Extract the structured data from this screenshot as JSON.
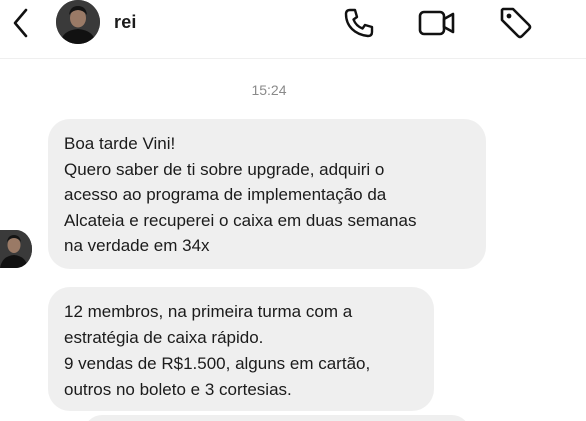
{
  "header": {
    "back_icon": "chevron-left-icon",
    "username": "rei",
    "actions": [
      {
        "icon": "phone-icon"
      },
      {
        "icon": "video-camera-icon"
      },
      {
        "icon": "tag-icon"
      }
    ]
  },
  "thread": {
    "timestamp": "15:24",
    "messages": [
      {
        "lines": [
          "Boa tarde Vini!",
          "Quero saber de ti sobre upgrade, adquiri o",
          "acesso ao programa de implementação da",
          "Alcateia e recuperei o caixa em duas semanas",
          "na verdade em 34x"
        ]
      },
      {
        "lines": [
          "12 membros, na primeira turma com a",
          "estratégia de caixa rápido.",
          "9 vendas de R$1.500, alguns em cartão,",
          "outros no boleto e 3 cortesias."
        ]
      }
    ]
  },
  "colors": {
    "bubble": "#efefef",
    "text": "#1b1b1b",
    "timestamp": "#8a8a8a"
  }
}
